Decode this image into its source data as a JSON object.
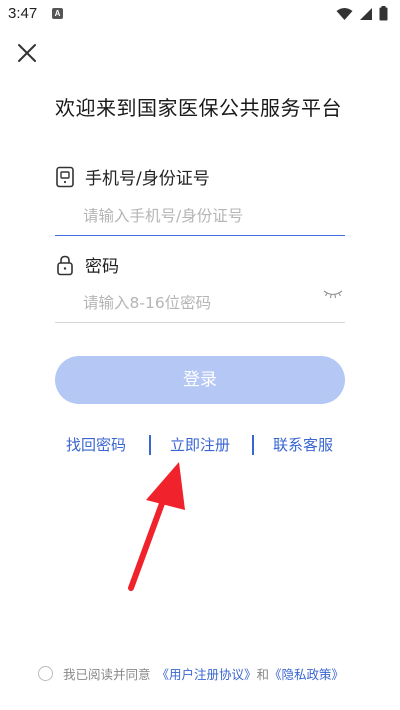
{
  "status_bar": {
    "time": "3:47",
    "a_badge": "A"
  },
  "header": {
    "close_icon": "close-icon"
  },
  "title": "欢迎来到国家医保公共服务平台",
  "phone_field": {
    "label": "手机号/身份证号",
    "placeholder": "请输入手机号/身份证号",
    "value": "",
    "icon": "phone-icon"
  },
  "password_field": {
    "label": "密码",
    "placeholder": "请输入8-16位密码",
    "value": "",
    "icon": "lock-icon",
    "toggle_icon": "eye-closed-icon"
  },
  "login_button": {
    "label": "登录",
    "color": "#b5c7f5"
  },
  "links": {
    "find_password": "找回密码",
    "register": "立即注册",
    "contact": "联系客服"
  },
  "agreement": {
    "prefix": "我已阅读并同意",
    "user_agreement": "《用户注册协议》",
    "and": "和",
    "privacy_policy": "《隐私政策》",
    "checked": false
  },
  "colors": {
    "accent": "#3a66d1",
    "annotation_arrow": "#f0222b"
  }
}
